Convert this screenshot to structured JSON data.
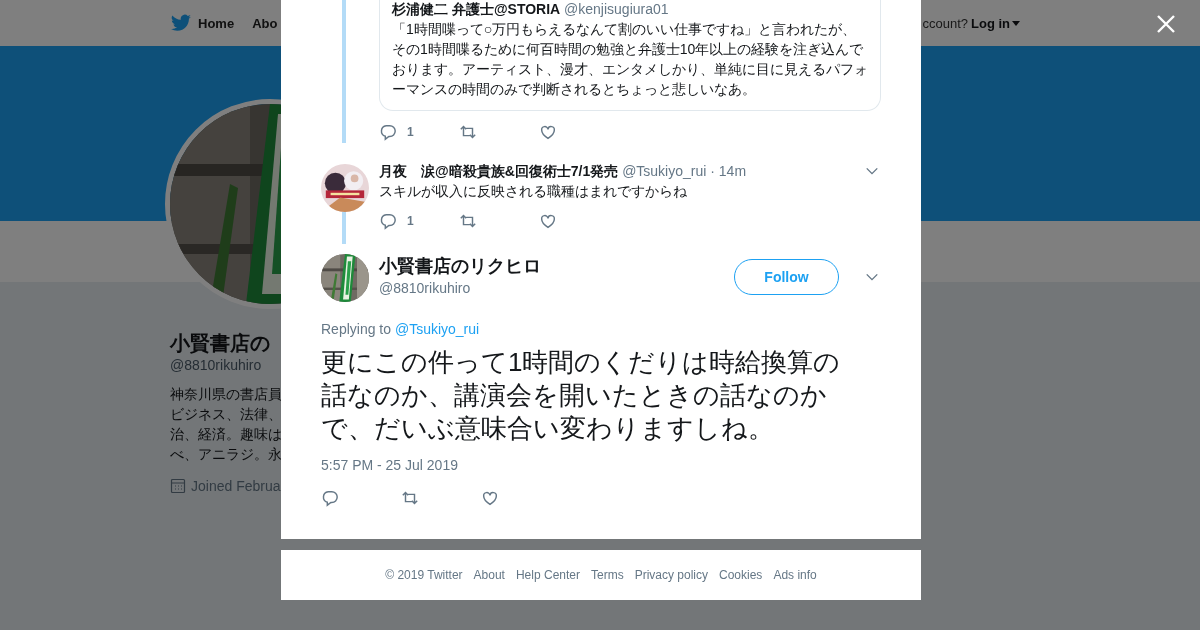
{
  "background_page": {
    "nav": {
      "items": [
        {
          "label": "Home",
          "kind": "home"
        },
        {
          "label": "Abo",
          "kind": "plain"
        }
      ],
      "account_prompt": "ccount?",
      "login": "Log in"
    },
    "profile": {
      "name": "小賢書店の",
      "handle": "@8810rikuhiro",
      "bio_lines": [
        "神奈川県の書店員",
        "ビジネス、法律、",
        "治、経済。趣味は",
        "べ、アニラジ。永"
      ],
      "joined": "Joined Februa"
    }
  },
  "dialog": {
    "thread": [
      {
        "kind": "quote_card",
        "name": "杉浦健二 弁護士@STORIA",
        "handle": "@kenjisugiura01",
        "text": "「1時間喋って○万円もらえるなんて割のいい仕事ですね」と言われたが、その1時間喋るために何百時間の勉強と弁護士10年以上の経験を注ぎ込んでおります。アーティスト、漫才、エンタメしかり、単純に目に見えるパフォーマンスの時間のみで判断されるとちょっと悲しいなあ。",
        "reply_count": "1"
      },
      {
        "kind": "tweet",
        "name": "月夜　涙@暗殺貴族&回復術士7/1発売",
        "meta": "@Tsukiyo_rui · 14m",
        "text": "スキルが収入に反映される職種はまれですからね",
        "reply_count": "1"
      }
    ],
    "main_tweet": {
      "name": "小賢書店のリクヒロ",
      "handle": "@8810rikuhiro",
      "follow_label": "Follow",
      "replying_to_label": "Replying to",
      "replying_to": "@Tsukiyo_rui",
      "text": "更にこの件って1時間のくだりは時給換算の話なのか、講演会を開いたときの話なのかで、だいぶ意味合い変わりますしね。",
      "timestamp": "5:57 PM - 25 Jul 2019"
    }
  },
  "footer": {
    "links": [
      "© 2019 Twitter",
      "About",
      "Help Center",
      "Terms",
      "Privacy policy",
      "Cookies",
      "Ads info"
    ]
  }
}
